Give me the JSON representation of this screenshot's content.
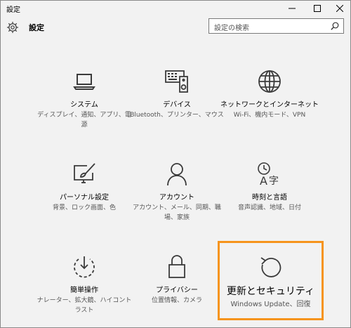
{
  "window": {
    "title": "設定"
  },
  "header": {
    "title": "設定"
  },
  "search": {
    "placeholder": "設定の検索"
  },
  "colors": {
    "accent": "#f6941d",
    "icon": "#3b3b3b",
    "background": "#f2f2f2"
  },
  "tiles": [
    {
      "icon": "laptop-icon",
      "name": "システム",
      "desc": "ディスプレイ、通知、アプリ、電源"
    },
    {
      "icon": "devices-icon",
      "name": "デバイス",
      "desc": "Bluetooth、プリンター、マウス"
    },
    {
      "icon": "globe-icon",
      "name": "ネットワークとインターネット",
      "desc": "Wi-Fi、機内モード、VPN"
    },
    {
      "icon": "personalization-icon",
      "name": "パーソナル設定",
      "desc": "背景、ロック画面、色"
    },
    {
      "icon": "person-icon",
      "name": "アカウント",
      "desc": "アカウント、メール、同期、職場、家族"
    },
    {
      "icon": "time-language-icon",
      "name": "時刻と言語",
      "desc": "音声認識、地域、日付"
    },
    {
      "icon": "ease-of-access-icon",
      "name": "簡単操作",
      "desc": "ナレーター、拡大鏡、ハイコントラスト"
    },
    {
      "icon": "lock-icon",
      "name": "プライバシー",
      "desc": "位置情報、カメラ"
    },
    {
      "icon": "refresh-icon",
      "name": "更新とセキュリティ",
      "desc": "Windows Update、回復"
    }
  ]
}
